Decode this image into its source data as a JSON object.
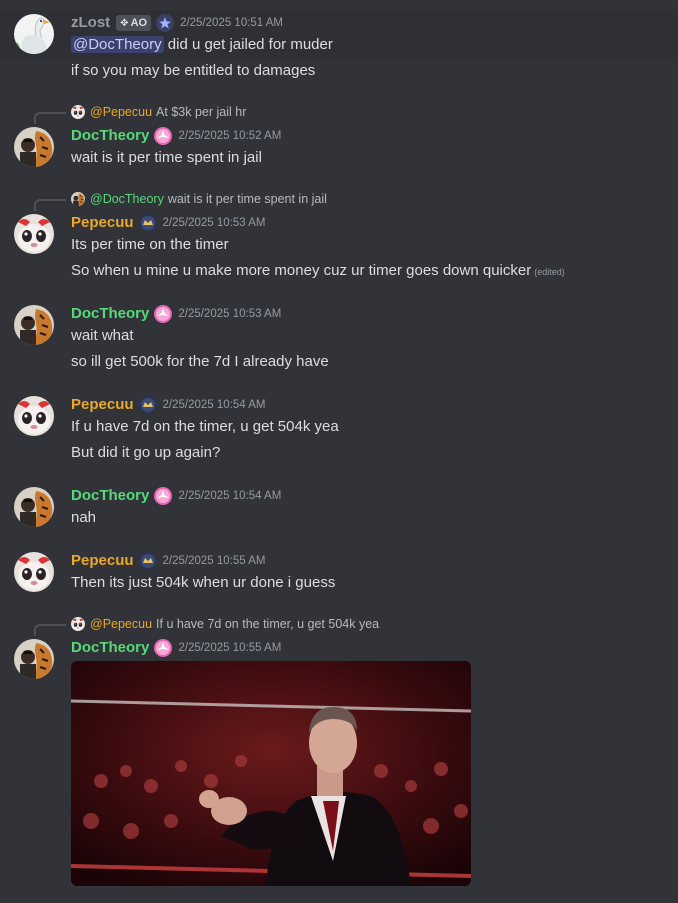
{
  "messages": [
    {
      "author": "zLost",
      "tag": "AO",
      "timestamp": "2/25/2025 10:51 AM",
      "mention": "@DocTheory",
      "lines": [
        "did u get jailed for muder",
        "if so you may be entitled to damages"
      ]
    },
    {
      "reply_to": {
        "author": "@Pepecuu",
        "text": "At $3k per jail hr"
      },
      "author": "DocTheory",
      "timestamp": "2/25/2025 10:52 AM",
      "lines": [
        "wait is it per time spent in jail"
      ]
    },
    {
      "reply_to": {
        "author": "@DocTheory",
        "text": "wait is it per time spent in jail"
      },
      "author": "Pepecuu",
      "timestamp": "2/25/2025 10:53 AM",
      "lines": [
        "Its per time on the timer",
        "So when u mine u make more money cuz ur timer goes down quicker"
      ],
      "edited": "(edited)"
    },
    {
      "author": "DocTheory",
      "timestamp": "2/25/2025 10:53 AM",
      "lines": [
        "wait what",
        "so ill get 500k for the 7d I already have"
      ]
    },
    {
      "author": "Pepecuu",
      "timestamp": "2/25/2025 10:54 AM",
      "lines": [
        "If u have 7d on the timer, u get 504k yea",
        "But did it go up again?"
      ]
    },
    {
      "author": "DocTheory",
      "timestamp": "2/25/2025 10:54 AM",
      "lines": [
        "nah"
      ]
    },
    {
      "author": "Pepecuu",
      "timestamp": "2/25/2025 10:55 AM",
      "lines": [
        "Then its just 504k when ur done i guess"
      ]
    },
    {
      "reply_to": {
        "author": "@Pepecuu",
        "text": "If u have 7d on the timer, u get 504k yea"
      },
      "author": "DocTheory",
      "timestamp": "2/25/2025 10:55 AM",
      "attachment": "gif-image"
    }
  ],
  "colors": {
    "background": "#313338",
    "doctheory": "#57d97a",
    "pepecuu": "#e9a82a",
    "zlost": "#949ba4",
    "mention_bg": "#3c4270"
  }
}
